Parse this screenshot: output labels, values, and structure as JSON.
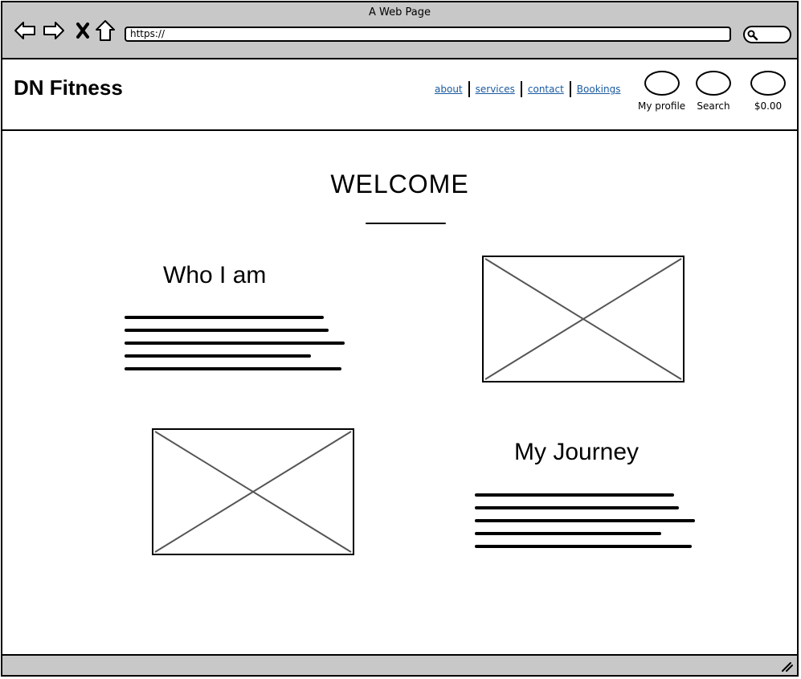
{
  "window": {
    "title": "A Web Page"
  },
  "browser": {
    "url": "https://",
    "icons": [
      "back-arrow-icon",
      "forward-arrow-icon",
      "close-icon",
      "home-icon",
      "search-icon"
    ]
  },
  "header": {
    "brand": "DN Fitness",
    "nav": [
      "about",
      "services",
      "contact",
      "Bookings"
    ],
    "actions": [
      {
        "label": "My profile"
      },
      {
        "label": "Search"
      },
      {
        "label": "$0.00"
      }
    ]
  },
  "main": {
    "title": "WELCOME",
    "sections": [
      {
        "heading": "Who I am"
      },
      {
        "heading": "My Journey"
      }
    ]
  },
  "colors": {
    "chrome": "#c8c8c8",
    "link": "#1a5aa0",
    "placeholder_stroke": "#555555"
  }
}
